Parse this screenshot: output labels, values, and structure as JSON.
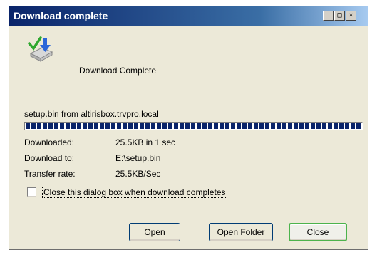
{
  "window": {
    "title": "Download complete",
    "controls": {
      "minimize": "_",
      "maximize": "□",
      "close": "×"
    }
  },
  "dialog": {
    "headline": "Download Complete",
    "source": "setup.bin from altirisbox.trvpro.local",
    "progress": 1.0,
    "info": [
      {
        "label": "Downloaded:",
        "value": "25.5KB in 1 sec"
      },
      {
        "label": "Download to:",
        "value": "E:\\setup.bin"
      },
      {
        "label": "Transfer rate:",
        "value": "25.5KB/Sec"
      }
    ],
    "checkbox": {
      "label": "Close this dialog box when download completes",
      "checked": false
    }
  },
  "buttons": {
    "open": "Open",
    "open_folder": "Open Folder",
    "close": "Close"
  },
  "icons": {
    "download": "download-complete-icon",
    "check": "green-checkmark",
    "arrow": "blue-down-arrow"
  },
  "colors": {
    "titlebar": "#0a246a",
    "progress": "#0a246a",
    "close_border": "#4cb34c",
    "dialog_bg": "#ece9d8"
  }
}
